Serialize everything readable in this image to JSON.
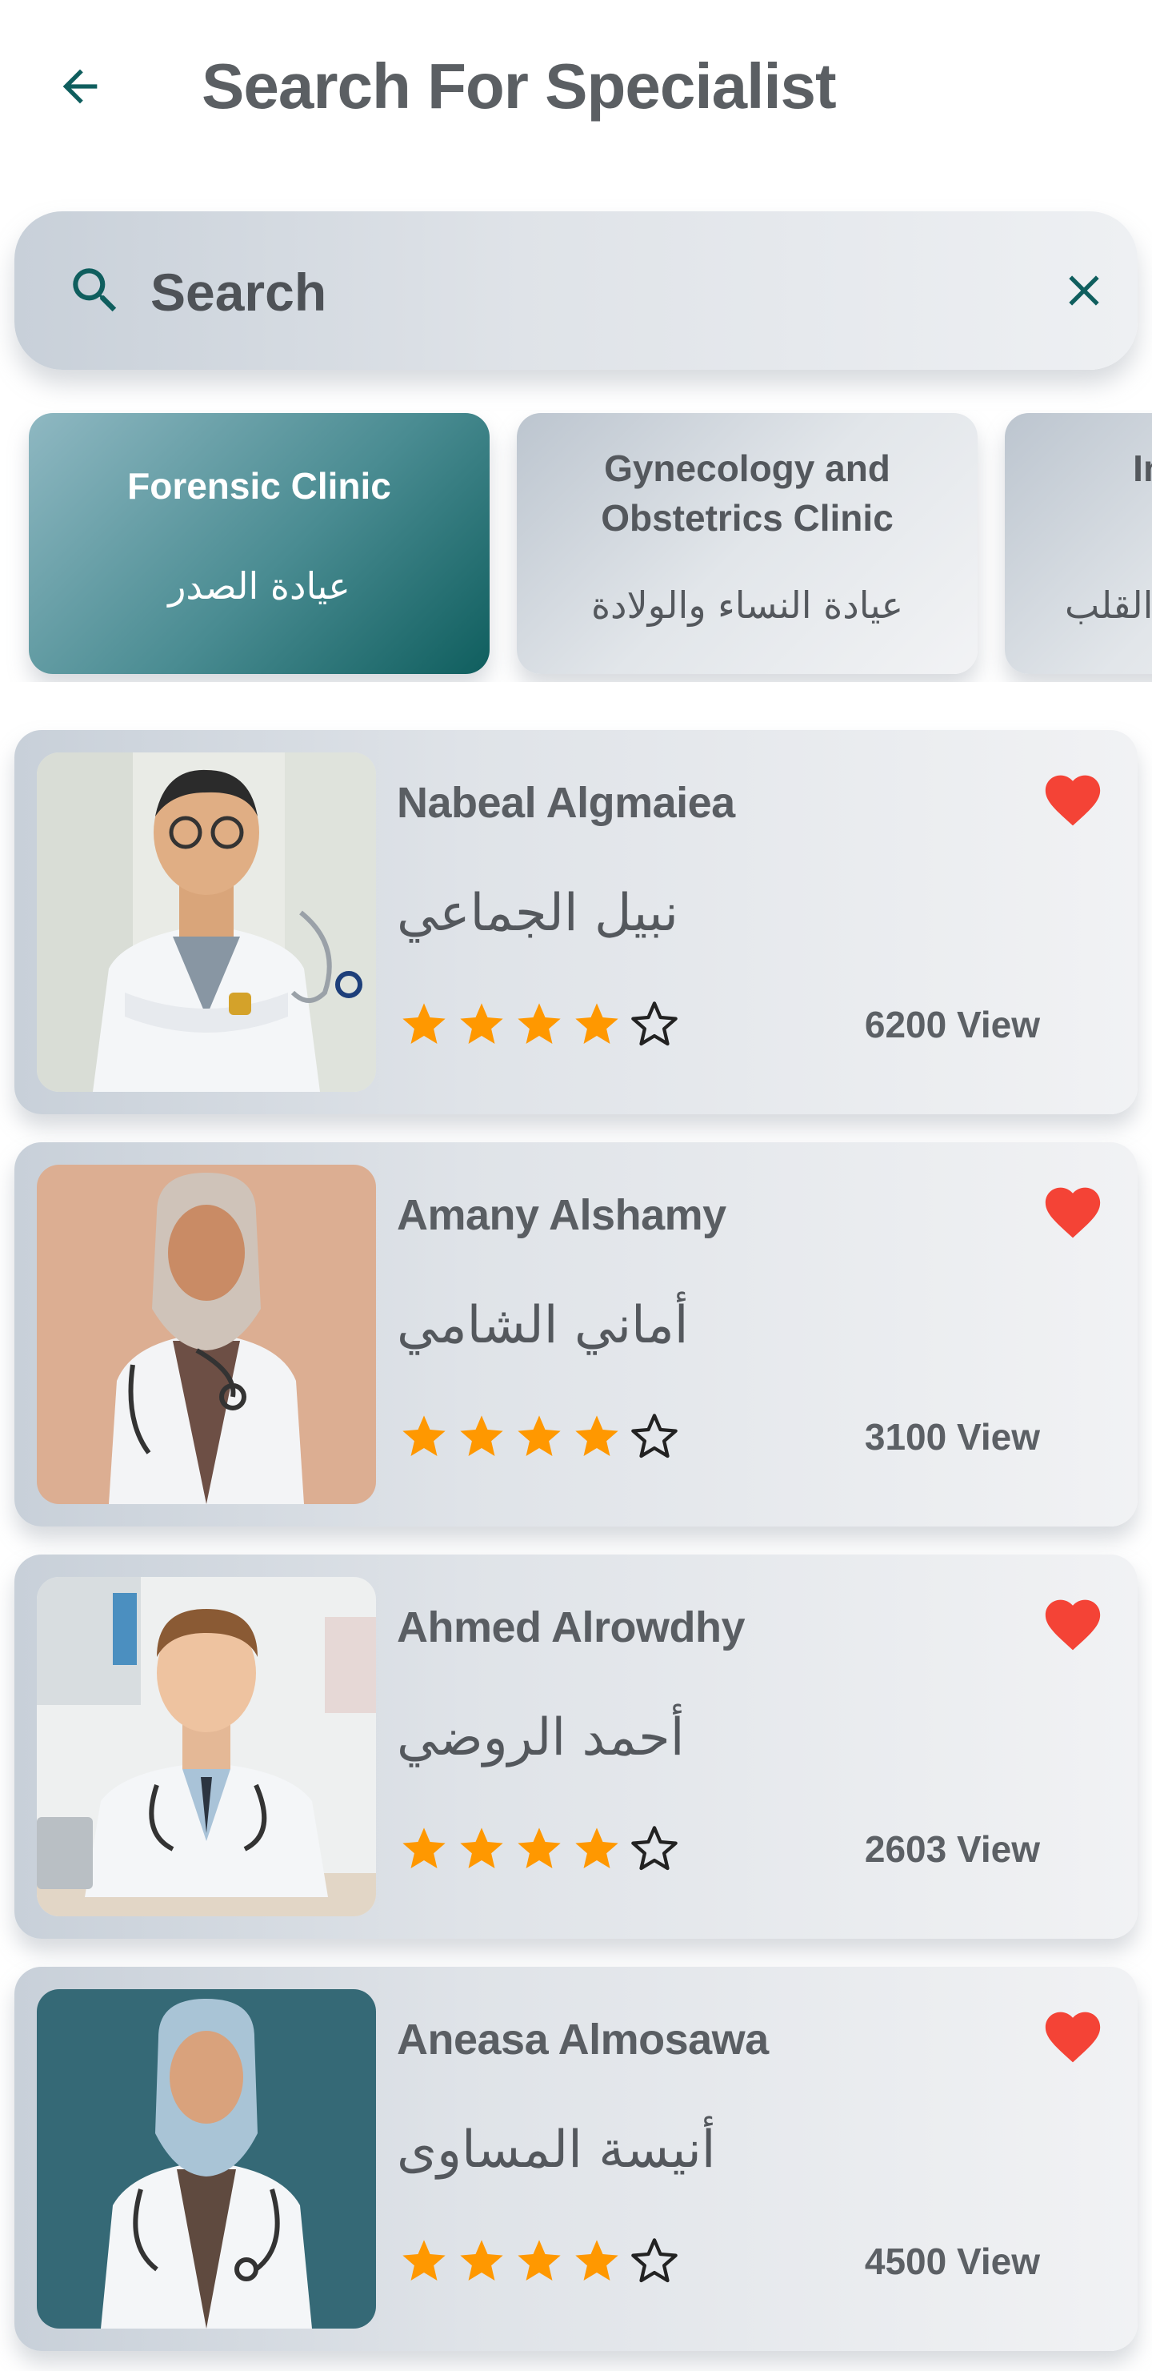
{
  "header": {
    "title": "Search For Specialist"
  },
  "search": {
    "placeholder": "Search",
    "value": ""
  },
  "colors": {
    "accent": "#0f5e5e",
    "star": "#ff9800",
    "heart": "#f44336"
  },
  "categories": [
    {
      "name_en": "Forensic Clinic",
      "name_ar": "عيادة الصدر",
      "active": true
    },
    {
      "name_en": "Gynecology and Obstetrics Clinic",
      "name_ar": "عيادة النساء والولادة",
      "active": false
    },
    {
      "name_en": "Internal Car",
      "name_ar": "القلب",
      "active": false
    }
  ],
  "doctors": [
    {
      "name_en": "Nabeal Algmaiea",
      "name_ar": "نبيل الجماعي",
      "rating": 4,
      "views": "6200 View",
      "favorite": true
    },
    {
      "name_en": "Amany Alshamy",
      "name_ar": "أماني الشامي",
      "rating": 4,
      "views": "3100 View",
      "favorite": true
    },
    {
      "name_en": "Ahmed Alrowdhy",
      "name_ar": "أحمد الروضي",
      "rating": 4,
      "views": "2603 View",
      "favorite": true
    },
    {
      "name_en": "Aneasa Almosawa",
      "name_ar": "أنيسة المساوى",
      "rating": 4,
      "views": "4500 View",
      "favorite": true
    }
  ],
  "icons": {
    "back": "arrow-left-icon",
    "search": "search-icon",
    "clear": "close-icon",
    "favorite": "heart-icon",
    "star": "star-icon"
  }
}
